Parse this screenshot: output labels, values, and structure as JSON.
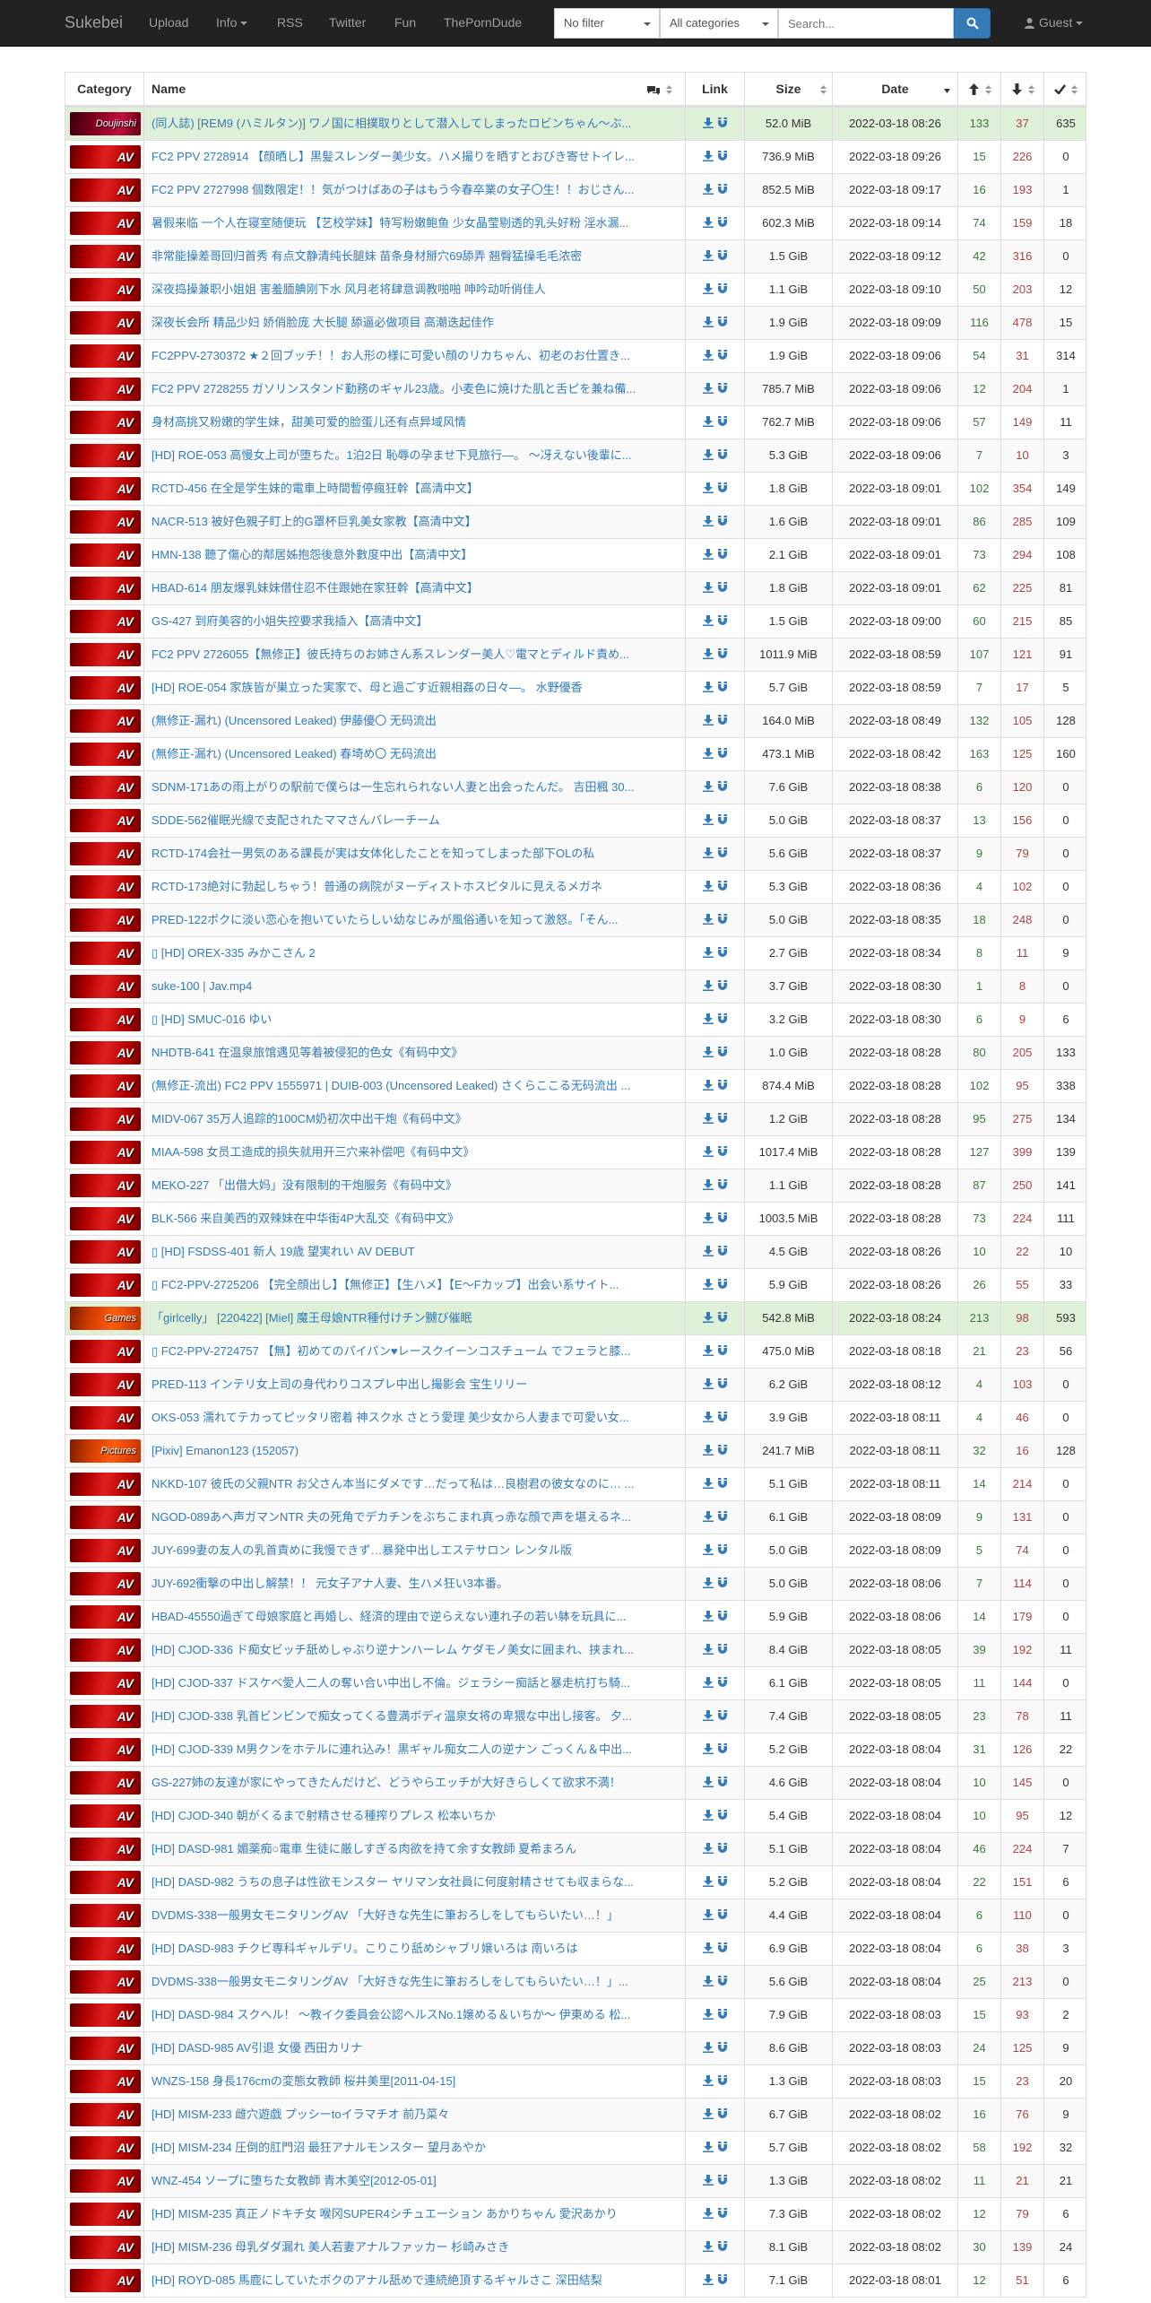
{
  "navbar": {
    "brand": "Sukebei",
    "links": [
      {
        "label": "Upload"
      },
      {
        "label": "Info"
      },
      {
        "label": "RSS"
      },
      {
        "label": "Twitter"
      },
      {
        "label": "Fun"
      },
      {
        "label": "ThePornDude"
      }
    ],
    "filter_value": "No filter",
    "category_value": "All categories",
    "search_placeholder": "Search...",
    "guest_label": "Guest"
  },
  "colors": {
    "navbar_bg": "#222222",
    "link": "#337ab7",
    "seeders": "#3c763d",
    "leechers": "#a94442",
    "trusted_row": "#dff0d8",
    "search_button": "#337ab7"
  },
  "table": {
    "headers": {
      "category": "Category",
      "name": "Name",
      "link": "Link",
      "size": "Size",
      "date": "Date"
    },
    "rows": [
      {
        "cat": "Doujinshi",
        "name": "(同人誌) [REM9 (ハミルタン)] ワノ国に相撲取りとして潜入してしまったロビンちゃん～ぶ...",
        "size": "52.0 MiB",
        "date": "2022-03-18 08:26",
        "se": "133",
        "le": "37",
        "co": "635",
        "trusted": true
      },
      {
        "cat": "AV",
        "name": "FC2 PPV 2728914 【顔晒し】黒髪スレンダー美少女。ハメ撮りを晒すとおびき寄せトイレ...",
        "size": "736.9 MiB",
        "date": "2022-03-18 09:26",
        "se": "15",
        "le": "226",
        "co": "0"
      },
      {
        "cat": "AV",
        "name": "FC2 PPV 2727998 個数限定！！気がつけばあの子はもう今春卒業の女子〇生！！おじさん...",
        "size": "852.5 MiB",
        "date": "2022-03-18 09:17",
        "se": "16",
        "le": "193",
        "co": "1"
      },
      {
        "cat": "AV",
        "name": "暑假来临 一个人在寝室随便玩 【艺校学妹】特写粉嫩鲍鱼 少女晶莹剔透的乳头好粉 淫水漏...",
        "size": "602.3 MiB",
        "date": "2022-03-18 09:14",
        "se": "74",
        "le": "159",
        "co": "18"
      },
      {
        "cat": "AV",
        "name": "非常能操差哥回归首秀 有点文静清纯长腿妹 苗条身材掰穴69舔弄 翘臀猛操毛毛浓密",
        "size": "1.5 GiB",
        "date": "2022-03-18 09:12",
        "se": "42",
        "le": "316",
        "co": "0"
      },
      {
        "cat": "AV",
        "name": "深夜捣操兼职小姐姐 害羞腼腆刚下水 风月老将肆意调教啪啪 呻吟动听俏佳人",
        "size": "1.1 GiB",
        "date": "2022-03-18 09:10",
        "se": "50",
        "le": "203",
        "co": "12"
      },
      {
        "cat": "AV",
        "name": "深夜长会所 精品少妇 娇俏脸庞 大长腿 舔逼必做项目 高潮迭起佳作",
        "size": "1.9 GiB",
        "date": "2022-03-18 09:09",
        "se": "116",
        "le": "478",
        "co": "15"
      },
      {
        "cat": "AV",
        "name": "FC2PPV-2730372 ★２回ブッチ！！お人形の様に可愛い顔のリカちゃん、初老のお仕置き...",
        "size": "1.9 GiB",
        "date": "2022-03-18 09:06",
        "se": "54",
        "le": "31",
        "co": "314"
      },
      {
        "cat": "AV",
        "name": "FC2 PPV 2728255 ガソリンスタンド勤務のギャル23歳。小麦色に焼けた肌と舌ピを兼ね備...",
        "size": "785.7 MiB",
        "date": "2022-03-18 09:06",
        "se": "12",
        "le": "204",
        "co": "1"
      },
      {
        "cat": "AV",
        "name": "身材高挑又粉嫩的学生妹，甜美可爱的脸蛋儿还有点异域风情",
        "size": "762.7 MiB",
        "date": "2022-03-18 09:06",
        "se": "57",
        "le": "149",
        "co": "11"
      },
      {
        "cat": "AV",
        "name": "[HD] ROE-053 高慢女上司が堕ちた。1泊2日 恥辱の孕ませ下見旅行―。 ～冴えない後輩に...",
        "size": "5.3 GiB",
        "date": "2022-03-18 09:06",
        "se": "7",
        "le": "10",
        "co": "3"
      },
      {
        "cat": "AV",
        "name": "RCTD-456 在全是学生妹的電車上時間暫停瘋狂幹【高清中文】",
        "size": "1.8 GiB",
        "date": "2022-03-18 09:01",
        "se": "102",
        "le": "354",
        "co": "149"
      },
      {
        "cat": "AV",
        "name": "NACR-513 被好色親子盯上的G罩杯巨乳美女家教【高清中文】",
        "size": "1.6 GiB",
        "date": "2022-03-18 09:01",
        "se": "86",
        "le": "285",
        "co": "109"
      },
      {
        "cat": "AV",
        "name": "HMN-138 聽了傷心的鄰居姊抱怨後意外數度中出【高清中文】",
        "size": "2.1 GiB",
        "date": "2022-03-18 09:01",
        "se": "73",
        "le": "294",
        "co": "108"
      },
      {
        "cat": "AV",
        "name": "HBAD-614 朋友爆乳妹妹借住忍不住跟她在家狂幹【高清中文】",
        "size": "1.8 GiB",
        "date": "2022-03-18 09:01",
        "se": "62",
        "le": "225",
        "co": "81"
      },
      {
        "cat": "AV",
        "name": "GS-427 到府美容的小姐失控要求我插入【高清中文】",
        "size": "1.5 GiB",
        "date": "2022-03-18 09:00",
        "se": "60",
        "le": "215",
        "co": "85"
      },
      {
        "cat": "AV",
        "name": "FC2 PPV 2726055【無修正】彼氏持ちのお姉さん系スレンダー美人♡電マとディルド責め...",
        "size": "1011.9 MiB",
        "date": "2022-03-18 08:59",
        "se": "107",
        "le": "121",
        "co": "91"
      },
      {
        "cat": "AV",
        "name": "[HD] ROE-054 家族皆が巣立った実家で、母と過ごす近親相姦の日々―。 水野優香",
        "size": "5.7 GiB",
        "date": "2022-03-18 08:59",
        "se": "7",
        "le": "17",
        "co": "5"
      },
      {
        "cat": "AV",
        "name": "(無修正-漏れ) (Uncensored Leaked) 伊藤優〇 无码流出",
        "size": "164.0 MiB",
        "date": "2022-03-18 08:49",
        "se": "132",
        "le": "105",
        "co": "128"
      },
      {
        "cat": "AV",
        "name": "(無修正-漏れ) (Uncensored Leaked) 春埼め〇 无码流出",
        "size": "473.1 MiB",
        "date": "2022-03-18 08:42",
        "se": "163",
        "le": "125",
        "co": "160"
      },
      {
        "cat": "AV",
        "name": "SDNM-171あの雨上がりの駅前で僕らは一生忘れられない人妻と出会ったんだ。 吉田楓 30...",
        "size": "7.6 GiB",
        "date": "2022-03-18 08:38",
        "se": "6",
        "le": "120",
        "co": "0"
      },
      {
        "cat": "AV",
        "name": "SDDE-562催眠光線で支配されたママさんバレーチーム",
        "size": "5.0 GiB",
        "date": "2022-03-18 08:37",
        "se": "13",
        "le": "156",
        "co": "0"
      },
      {
        "cat": "AV",
        "name": "RCTD-174会社一男気のある課長が実は女体化したことを知ってしまった部下OLの私",
        "size": "5.6 GiB",
        "date": "2022-03-18 08:37",
        "se": "9",
        "le": "79",
        "co": "0"
      },
      {
        "cat": "AV",
        "name": "RCTD-173絶対に勃起しちゃう！普通の病院がヌーディストホスピタルに見えるメガネ",
        "size": "5.3 GiB",
        "date": "2022-03-18 08:36",
        "se": "4",
        "le": "102",
        "co": "0"
      },
      {
        "cat": "AV",
        "name": "PRED-122ボクに淡い恋心を抱いていたらしい幼なじみが風俗通いを知って激怒。「そん...",
        "size": "5.0 GiB",
        "date": "2022-03-18 08:35",
        "se": "18",
        "le": "248",
        "co": "0"
      },
      {
        "cat": "AV",
        "name": "▯ [HD] OREX-335 みかこさん 2",
        "size": "2.7 GiB",
        "date": "2022-03-18 08:34",
        "se": "8",
        "le": "11",
        "co": "9"
      },
      {
        "cat": "AV",
        "name": "suke-100 | Jav.mp4",
        "size": "3.7 GiB",
        "date": "2022-03-18 08:30",
        "se": "1",
        "le": "8",
        "co": "0"
      },
      {
        "cat": "AV",
        "name": "▯ [HD] SMUC-016 ゆい",
        "size": "3.2 GiB",
        "date": "2022-03-18 08:30",
        "se": "6",
        "le": "9",
        "co": "6"
      },
      {
        "cat": "AV",
        "name": "NHDTB-641 在温泉旅馆遇见等着被侵犯的色女《有码中文》",
        "size": "1.0 GiB",
        "date": "2022-03-18 08:28",
        "se": "80",
        "le": "205",
        "co": "133"
      },
      {
        "cat": "AV",
        "name": "(無修正-流出) FC2 PPV 1555971 | DUIB-003 (Uncensored Leaked) さくらここる无码流出 ...",
        "size": "874.4 MiB",
        "date": "2022-03-18 08:28",
        "se": "102",
        "le": "95",
        "co": "338"
      },
      {
        "cat": "AV",
        "name": "MIDV-067 35万人追踪的100CM奶初次中出干炮《有码中文》",
        "size": "1.2 GiB",
        "date": "2022-03-18 08:28",
        "se": "95",
        "le": "275",
        "co": "134"
      },
      {
        "cat": "AV",
        "name": "MIAA-598 女员工造成的损失就用开三穴来补偿吧《有码中文》",
        "size": "1017.4 MiB",
        "date": "2022-03-18 08:28",
        "se": "127",
        "le": "399",
        "co": "139"
      },
      {
        "cat": "AV",
        "name": "MEKO-227 「出借大妈」没有限制的干炮服务《有码中文》",
        "size": "1.1 GiB",
        "date": "2022-03-18 08:28",
        "se": "87",
        "le": "250",
        "co": "141"
      },
      {
        "cat": "AV",
        "name": "BLK-566 来自美西的双辣妹在中华街4P大乱交《有码中文》",
        "size": "1003.5 MiB",
        "date": "2022-03-18 08:28",
        "se": "73",
        "le": "224",
        "co": "111"
      },
      {
        "cat": "AV",
        "name": "▯ [HD] FSDSS-401 新人 19歳 望実れい AV DEBUT",
        "size": "4.5 GiB",
        "date": "2022-03-18 08:26",
        "se": "10",
        "le": "22",
        "co": "10"
      },
      {
        "cat": "AV",
        "name": "▯ FC2-PPV-2725206 【完全顔出し】【無修正】【生ハメ】【E～Fカップ】出会い系サイト...",
        "size": "5.9 GiB",
        "date": "2022-03-18 08:26",
        "se": "26",
        "le": "55",
        "co": "33"
      },
      {
        "cat": "Games",
        "name": "「girlcelly」 [220422] [Miel] 魔王母娘NTR種付けチン嬲び催眠",
        "size": "542.8 MiB",
        "date": "2022-03-18 08:24",
        "se": "213",
        "le": "98",
        "co": "593",
        "trusted": true
      },
      {
        "cat": "AV",
        "name": "▯ FC2-PPV-2724757 【無】初めてのパイパン♥レースクイーンコスチューム でフェラと膝...",
        "size": "475.0 MiB",
        "date": "2022-03-18 08:18",
        "se": "21",
        "le": "23",
        "co": "56"
      },
      {
        "cat": "AV",
        "name": "PRED-113 インテリ女上司の身代わりコスプレ中出し撮影会 宝生リリー",
        "size": "6.2 GiB",
        "date": "2022-03-18 08:12",
        "se": "4",
        "le": "103",
        "co": "0"
      },
      {
        "cat": "AV",
        "name": "OKS-053 濡れてテカってピッタリ密着 神スク水 さとう愛理 美少女から人妻まで可愛い女...",
        "size": "3.9 GiB",
        "date": "2022-03-18 08:11",
        "se": "4",
        "le": "46",
        "co": "0"
      },
      {
        "cat": "Pictures",
        "name": "[Pixiv] Emanon123 (152057)",
        "size": "241.7 MiB",
        "date": "2022-03-18 08:11",
        "se": "32",
        "le": "16",
        "co": "128"
      },
      {
        "cat": "AV",
        "name": "NKKD-107 彼氏の父親NTR お父さん本当にダメです…だって私は…良樹君の彼女なのに… ...",
        "size": "5.1 GiB",
        "date": "2022-03-18 08:11",
        "se": "14",
        "le": "214",
        "co": "0"
      },
      {
        "cat": "AV",
        "name": "NGOD-089あへ声ガマンNTR 夫の死角でデカチンをぶちこまれ真っ赤な顔で声を堪えるネ...",
        "size": "6.1 GiB",
        "date": "2022-03-18 08:09",
        "se": "9",
        "le": "131",
        "co": "0"
      },
      {
        "cat": "AV",
        "name": "JUY-699妻の友人の乳首責めに我慢できず…暴発中出しエステサロン レンタル版",
        "size": "5.0 GiB",
        "date": "2022-03-18 08:09",
        "se": "5",
        "le": "74",
        "co": "0"
      },
      {
        "cat": "AV",
        "name": "JUY-692衝撃の中出し解禁！！ 元女子アナ人妻、生ハメ狂い3本番。",
        "size": "5.0 GiB",
        "date": "2022-03-18 08:06",
        "se": "7",
        "le": "114",
        "co": "0"
      },
      {
        "cat": "AV",
        "name": "HBAD-45550過ぎて母娘家庭と再婚し、経済的理由で逆らえない連れ子の若い躰を玩具に...",
        "size": "5.9 GiB",
        "date": "2022-03-18 08:06",
        "se": "14",
        "le": "179",
        "co": "0"
      },
      {
        "cat": "AV",
        "name": "[HD] CJOD-336 ド痴女ビッチ舐めしゃぶり逆ナンハーレム ケダモノ美女に囲まれ、挟まれ...",
        "size": "8.4 GiB",
        "date": "2022-03-18 08:05",
        "se": "39",
        "le": "192",
        "co": "11"
      },
      {
        "cat": "AV",
        "name": "[HD] CJOD-337 ドスケベ愛人二人の奪い合い中出し不倫。ジェラシー痴話と暴走杭打ち騎...",
        "size": "6.1 GiB",
        "date": "2022-03-18 08:05",
        "se": "11",
        "le": "144",
        "co": "0"
      },
      {
        "cat": "AV",
        "name": "[HD] CJOD-338 乳首ビンビンで痴女ってくる豊満ボディ温泉女将の卑猥な中出し接客。 夕...",
        "size": "7.4 GiB",
        "date": "2022-03-18 08:05",
        "se": "23",
        "le": "78",
        "co": "11"
      },
      {
        "cat": "AV",
        "name": "[HD] CJOD-339 M男クンをホテルに連れ込み！黒ギャル痴女二人の逆ナン ごっくん＆中出...",
        "size": "5.2 GiB",
        "date": "2022-03-18 08:04",
        "se": "31",
        "le": "126",
        "co": "22"
      },
      {
        "cat": "AV",
        "name": "GS-227姉の友達が家にやってきたんだけど、どうやらエッチが大好きらしくて欲求不満！",
        "size": "4.6 GiB",
        "date": "2022-03-18 08:04",
        "se": "10",
        "le": "145",
        "co": "0"
      },
      {
        "cat": "AV",
        "name": "[HD] CJOD-340 朝がくるまで射精させる種搾りプレス 松本いちか",
        "size": "5.4 GiB",
        "date": "2022-03-18 08:04",
        "se": "10",
        "le": "95",
        "co": "12"
      },
      {
        "cat": "AV",
        "name": "[HD] DASD-981 媚薬痴○電車 生徒に厳しすぎる肉欲を持て余す女教師 夏希まろん",
        "size": "5.1 GiB",
        "date": "2022-03-18 08:04",
        "se": "46",
        "le": "224",
        "co": "7"
      },
      {
        "cat": "AV",
        "name": "[HD] DASD-982 うちの息子は性欲モンスター ヤリマン女社員に何度射精させても収まらな...",
        "size": "5.2 GiB",
        "date": "2022-03-18 08:04",
        "se": "22",
        "le": "151",
        "co": "6"
      },
      {
        "cat": "AV",
        "name": "DVDMS-338一般男女モニタリングAV 「大好きな先生に筆おろしをしてもらいたい…！」",
        "size": "4.4 GiB",
        "date": "2022-03-18 08:04",
        "se": "6",
        "le": "110",
        "co": "0"
      },
      {
        "cat": "AV",
        "name": "[HD] DASD-983 チクビ専科ギャルデリ。こりこり舐めシャブリ嬢いろは 南いろは",
        "size": "6.9 GiB",
        "date": "2022-03-18 08:04",
        "se": "6",
        "le": "38",
        "co": "3"
      },
      {
        "cat": "AV",
        "name": "DVDMS-338一般男女モニタリングAV 「大好きな先生に筆おろしをしてもらいたい…！」...",
        "size": "5.6 GiB",
        "date": "2022-03-18 08:04",
        "se": "25",
        "le": "213",
        "co": "0"
      },
      {
        "cat": "AV",
        "name": "[HD] DASD-984 スクへル！ ～教イク委員会公認ヘルスNo.1嬢める＆いちか～ 伊東める 松...",
        "size": "7.9 GiB",
        "date": "2022-03-18 08:03",
        "se": "15",
        "le": "93",
        "co": "2"
      },
      {
        "cat": "AV",
        "name": "[HD] DASD-985 AV引退 女優 西田カリナ",
        "size": "8.6 GiB",
        "date": "2022-03-18 08:03",
        "se": "24",
        "le": "125",
        "co": "9"
      },
      {
        "cat": "AV",
        "name": "WNZS-158 身長176cmの変態女教師 桜井美里[2011-04-15]",
        "size": "1.3 GiB",
        "date": "2022-03-18 08:03",
        "se": "15",
        "le": "23",
        "co": "20"
      },
      {
        "cat": "AV",
        "name": "[HD] MISM-233 雌穴遊戯 プッシーtoイラマチオ 前乃菜々",
        "size": "6.7 GiB",
        "date": "2022-03-18 08:02",
        "se": "16",
        "le": "76",
        "co": "9"
      },
      {
        "cat": "AV",
        "name": "[HD] MISM-234 圧倒的肛門沼 最狂アナルモンスター 望月あやか",
        "size": "5.7 GiB",
        "date": "2022-03-18 08:02",
        "se": "58",
        "le": "192",
        "co": "32"
      },
      {
        "cat": "AV",
        "name": "WNZ-454 ソープに堕ちた女教師 青木美空[2012-05-01]",
        "size": "1.3 GiB",
        "date": "2022-03-18 08:02",
        "se": "11",
        "le": "21",
        "co": "21"
      },
      {
        "cat": "AV",
        "name": "[HD] MISM-235 真正ノドキチ女 喉冈SUPER4シチュエーション あかりちゃん 愛沢あかり",
        "size": "7.3 GiB",
        "date": "2022-03-18 08:02",
        "se": "12",
        "le": "79",
        "co": "6"
      },
      {
        "cat": "AV",
        "name": "[HD] MISM-236 母乳ダダ漏れ 美人若妻アナルファッカー 杉崎みさき",
        "size": "8.1 GiB",
        "date": "2022-03-18 08:02",
        "se": "30",
        "le": "139",
        "co": "24"
      },
      {
        "cat": "AV",
        "name": "[HD] ROYD-085 馬鹿にしていたボクのアナル舐めで連続絶頂するギャルさこ 深田結梨",
        "size": "7.1 GiB",
        "date": "2022-03-18 08:01",
        "se": "12",
        "le": "51",
        "co": "6"
      }
    ]
  }
}
